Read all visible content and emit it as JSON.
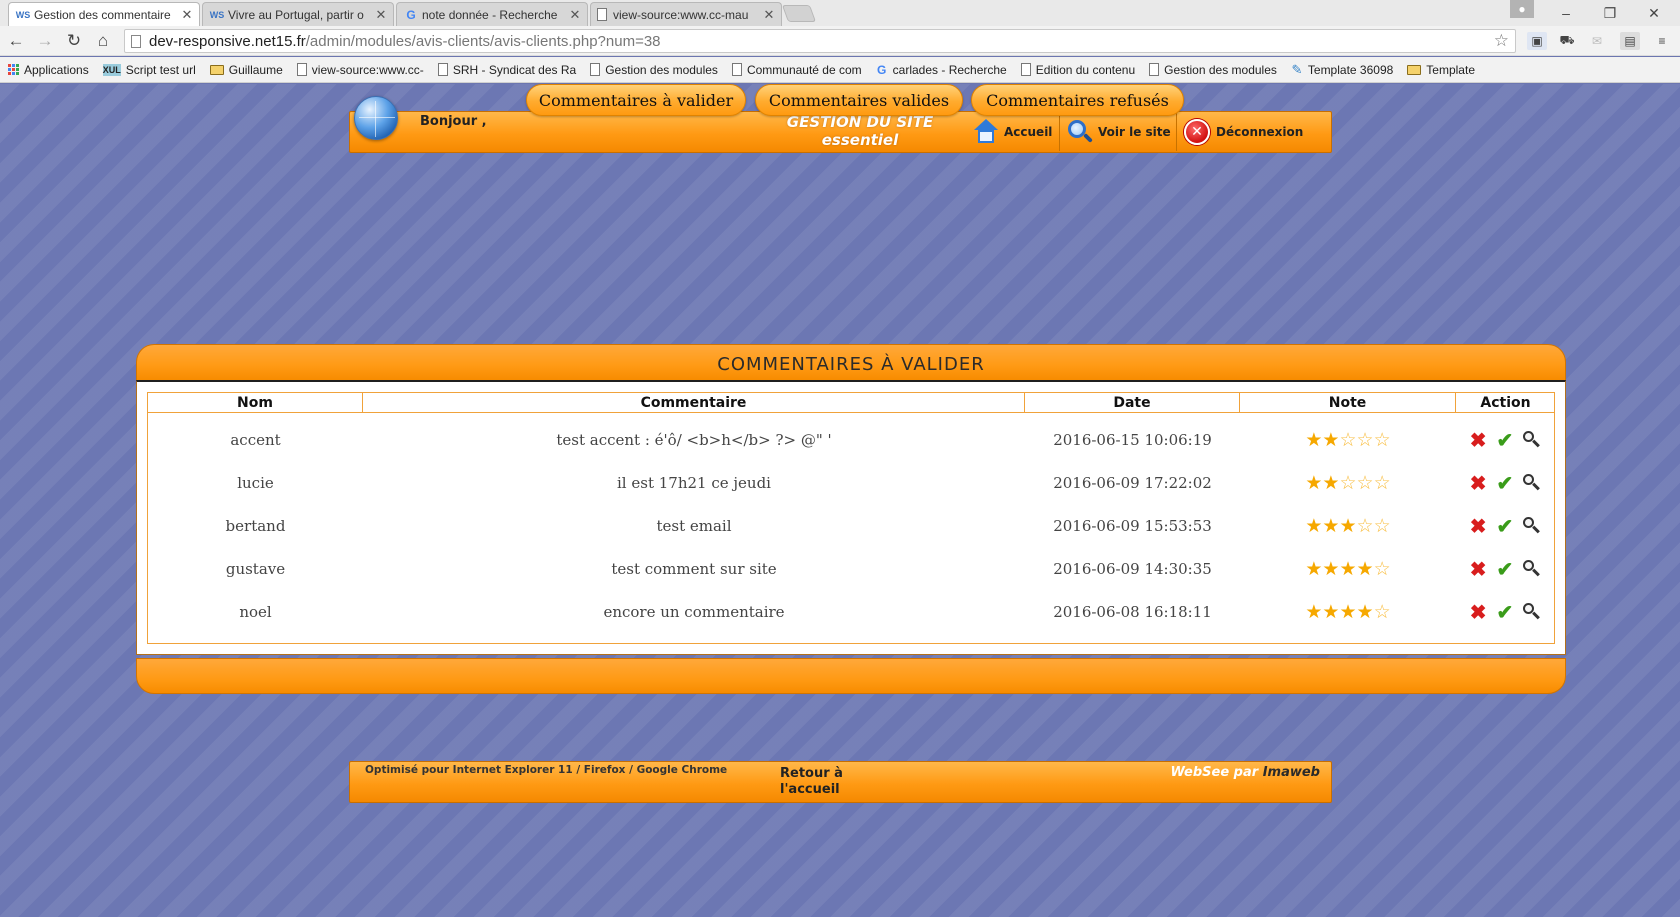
{
  "browser": {
    "tabs": [
      {
        "favicon": "WS",
        "title": "Gestion des commentaire",
        "active": true
      },
      {
        "favicon": "WS",
        "title": "Vivre au Portugal, partir o",
        "active": false
      },
      {
        "favicon": "G",
        "title": "note donnée - Recherche",
        "active": false
      },
      {
        "favicon": "",
        "title": "view-source:www.cc-mau",
        "active": false
      }
    ],
    "url_host": "dev-responsive.net15.fr",
    "url_path": "/admin/modules/avis-clients/avis-clients.php?num=38",
    "bookmarks": [
      {
        "icon": "apps-icon",
        "label": "Applications"
      },
      {
        "icon": "xul-icon",
        "label": "Script test url"
      },
      {
        "icon": "folder-icon",
        "label": "Guillaume"
      },
      {
        "icon": "page-icon",
        "label": "view-source:www.cc-"
      },
      {
        "icon": "page-icon",
        "label": "SRH - Syndicat des Ra"
      },
      {
        "icon": "page-icon",
        "label": "Gestion des modules"
      },
      {
        "icon": "page-icon",
        "label": "Communauté de com"
      },
      {
        "icon": "google-icon",
        "label": "carlades - Recherche"
      },
      {
        "icon": "page-icon",
        "label": "Edition du contenu"
      },
      {
        "icon": "page-icon",
        "label": "Gestion des modules"
      },
      {
        "icon": "template-icon",
        "label": "Template 36098"
      },
      {
        "icon": "folder-icon",
        "label": "Template"
      }
    ]
  },
  "header": {
    "greeting": "Bonjour ,",
    "title_line1": "GESTION DU SITE",
    "title_line2": "essentiel",
    "nav": {
      "home": "Accueil",
      "view_site": "Voir le site",
      "logout": "Déconnexion"
    }
  },
  "tabs": {
    "pending": "Commentaires à valider",
    "valid": "Commentaires valides",
    "refused": "Commentaires refusés"
  },
  "panel": {
    "title": "COMMENTAIRES À VALIDER",
    "columns": {
      "name": "Nom",
      "comment": "Commentaire",
      "date": "Date",
      "rating": "Note",
      "action": "Action"
    },
    "rows": [
      {
        "name": "accent",
        "comment": "test accent : é'ô/ <b>h</b> ?> @\" '",
        "date": "2016-06-15 10:06:19",
        "rating": 2
      },
      {
        "name": "lucie",
        "comment": "il est 17h21 ce jeudi",
        "date": "2016-06-09 17:22:02",
        "rating": 2
      },
      {
        "name": "bertand",
        "comment": "test email",
        "date": "2016-06-09 15:53:53",
        "rating": 3
      },
      {
        "name": "gustave",
        "comment": "test comment sur site",
        "date": "2016-06-09 14:30:35",
        "rating": 4
      },
      {
        "name": "noel",
        "comment": "encore un commentaire",
        "date": "2016-06-08 16:18:11",
        "rating": 4
      }
    ],
    "rating_max": 5
  },
  "footer": {
    "optimized": "Optimisé pour Internet Explorer 11 / Firefox / Google Chrome",
    "back_line1": "Retour à",
    "back_line2": "l'accueil",
    "credit_prefix": "WebSee par",
    "credit_brand": "Imaweb"
  },
  "colors": {
    "accent": "#ff9a14",
    "background": "#6c76b0",
    "star": "#f6a800",
    "delete": "#d81d1d",
    "validate": "#3a9c1a"
  }
}
